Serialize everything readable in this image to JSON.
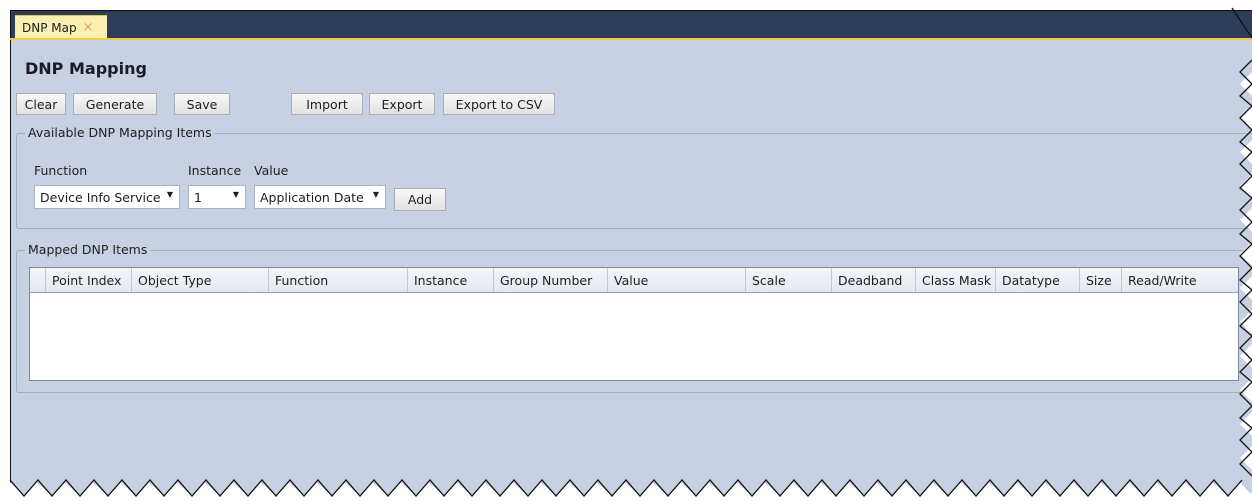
{
  "tab": {
    "label": "DNP Map",
    "close_glyph": "×"
  },
  "page": {
    "title": "DNP Mapping"
  },
  "toolbar": {
    "clear": "Clear",
    "generate": "Generate",
    "save": "Save",
    "import": "Import",
    "export": "Export",
    "export_csv": "Export to CSV"
  },
  "available": {
    "legend": "Available DNP Mapping Items",
    "function_label": "Function",
    "instance_label": "Instance",
    "value_label": "Value",
    "function_value": "Device Info Service",
    "instance_value": "1",
    "value_value": "Application Date",
    "add_label": "Add"
  },
  "mapped": {
    "legend": "Mapped DNP Items",
    "columns": [
      "Point Index",
      "Object Type",
      "Function",
      "Instance",
      "Group Number",
      "Value",
      "Scale",
      "Deadband",
      "Class Mask",
      "Datatype",
      "Size",
      "Read/Write"
    ],
    "rows": []
  },
  "colors": {
    "title_bar": "#2c3d5a",
    "tab_background": "#fbf0b2",
    "tab_accent": "#f5c842",
    "content_background": "#c8d1e3"
  }
}
